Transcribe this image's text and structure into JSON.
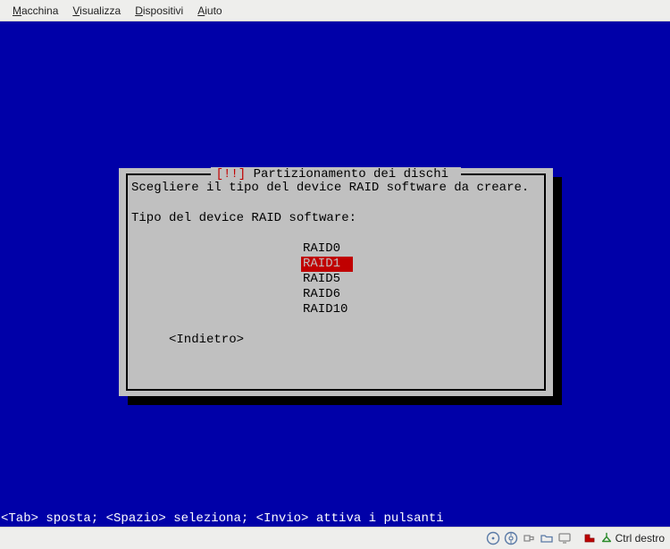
{
  "menubar": {
    "items": [
      {
        "hot": "M",
        "rest": "acchina"
      },
      {
        "hot": "V",
        "rest": "isualizza"
      },
      {
        "hot": "D",
        "rest": "ispositivi"
      },
      {
        "hot": "A",
        "rest": "iuto"
      }
    ]
  },
  "dialog": {
    "title_marker": "[!!]",
    "title_text": "Partizionamento dei dischi",
    "instruction": "Scegliere il tipo del device RAID software da creare.",
    "field_label": "Tipo del device RAID software:",
    "options": [
      "RAID0",
      "RAID1",
      "RAID5",
      "RAID6",
      "RAID10"
    ],
    "selected_index": 1,
    "back_label": "<Indietro>"
  },
  "hintbar": "<Tab> sposta; <Spazio> seleziona; <Invio> attiva i pulsanti",
  "statusbar": {
    "host_key": "Ctrl destro"
  }
}
